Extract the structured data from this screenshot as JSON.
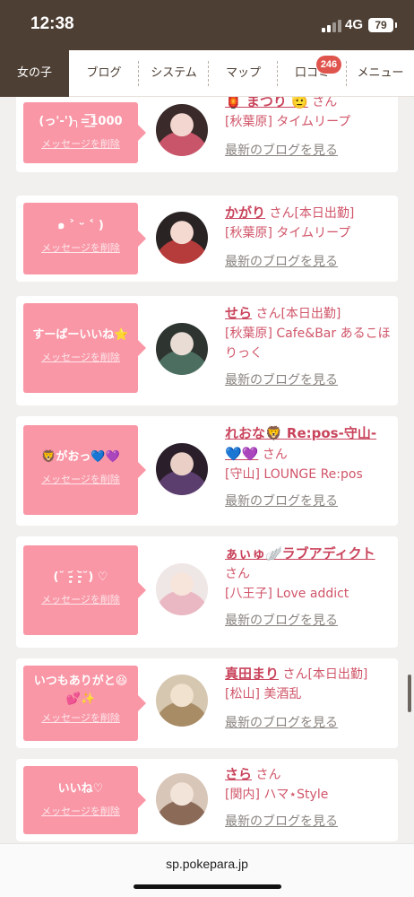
{
  "status_bar": {
    "time": "12:38",
    "network": "4G",
    "battery": "79"
  },
  "nav": {
    "tabs": [
      {
        "label": "女の子",
        "active": true
      },
      {
        "label": "ブログ"
      },
      {
        "label": "システム"
      },
      {
        "label": "マップ"
      },
      {
        "label": "口コミ",
        "badge": "246"
      },
      {
        "label": "メニュー"
      }
    ]
  },
  "delete_label": "メッセージを削除",
  "san_label": "さん",
  "blog_label": "最新のブログを見る",
  "cards": [
    {
      "message": "(っ'-')╮=͟͟͞͞1000",
      "name": "🏮 まつり 🫡",
      "tag": "",
      "area": "[秋葉原]",
      "shop": "タイムリープ",
      "avatar_colors": [
        "#3a2a2a",
        "#c9556a",
        "#f2d6cf"
      ]
    },
    {
      "message": "๑ ˃ ᵕ ˂ )",
      "name": "かがり",
      "tag": "[本日出勤]",
      "area": "[秋葉原]",
      "shop": "タイムリープ",
      "avatar_colors": [
        "#2a2323",
        "#b63b3b",
        "#f4d9d0"
      ]
    },
    {
      "message": "すーぱーいいね⭐️",
      "name": "せら",
      "tag": "[本日出勤]",
      "area": "[秋葉原]",
      "shop": "Cafe&Bar あるこほりっく",
      "avatar_colors": [
        "#2e3531",
        "#4c6e60",
        "#e8dcd4"
      ]
    },
    {
      "message": "🦁がおっ💙💜",
      "name": "れおな🦁 Re:pos-守山-💙💜",
      "tag": "",
      "area": "[守山]",
      "shop": "LOUNGE Re:pos",
      "avatar_colors": [
        "#2a1e2a",
        "#5b3d6e",
        "#e9cfc5"
      ]
    },
    {
      "message": "(˘ -̥̥̥᷄ -̥̥̥᷅˘) ♡",
      "name": "ぁぃゅ🪽ラブアディクト",
      "tag": "",
      "area": "[八王子]",
      "shop": "Love addict",
      "avatar_colors": [
        "#efe6e6",
        "#e9b8c2",
        "#f7e4da"
      ]
    },
    {
      "message": "いつもありがと😆💕✨",
      "name": "真田まり",
      "tag": "[本日出勤]",
      "area": "[松山]",
      "shop": "美酒乱",
      "avatar_colors": [
        "#d6c7b0",
        "#a88c66",
        "#f0e2cf"
      ]
    },
    {
      "message": "いいね♡",
      "name": "さら",
      "tag": "",
      "area": "[関内]",
      "shop": "ハマ⋆Style",
      "avatar_colors": [
        "#d8c6b8",
        "#8b6b58",
        "#f3e4da"
      ]
    }
  ],
  "url_bar": {
    "url": "sp.pokepara.jp"
  }
}
